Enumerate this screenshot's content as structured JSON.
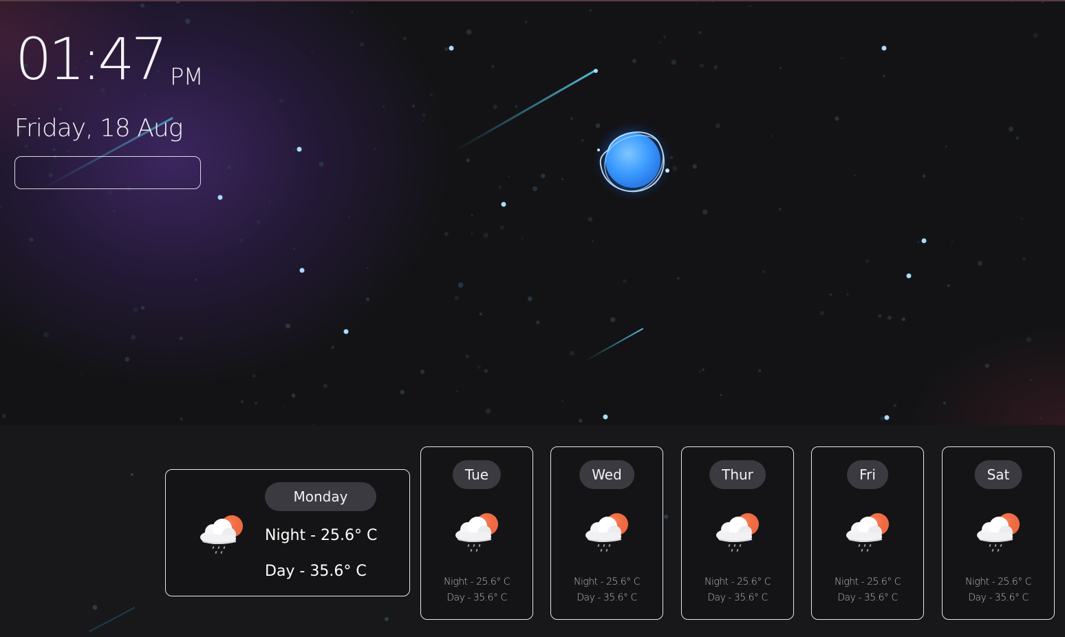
{
  "clock": {
    "time": "01:47",
    "ampm": "PM",
    "date": "Friday, 18 Aug"
  },
  "search": {
    "value": "",
    "placeholder": ""
  },
  "colors": {
    "background": "#131315",
    "panel": "#18181b",
    "pill": "#3a3a40",
    "moon": "#3a9dff",
    "star": "#a9dcff"
  },
  "forecast": {
    "today": {
      "day": "Monday",
      "night": "Night - 25.6° C",
      "daytemp": "Day - 35.6° C",
      "icon": "rain-cloud-sun-icon"
    },
    "days": [
      {
        "day": "Tue",
        "night": "Night - 25.6° C",
        "daytemp": "Day - 35.6° C",
        "icon": "rain-cloud-sun-icon"
      },
      {
        "day": "Wed",
        "night": "Night - 25.6° C",
        "daytemp": "Day - 35.6° C",
        "icon": "rain-cloud-sun-icon"
      },
      {
        "day": "Thur",
        "night": "Night - 25.6° C",
        "daytemp": "Day - 35.6° C",
        "icon": "rain-cloud-sun-icon"
      },
      {
        "day": "Fri",
        "night": "Night - 25.6° C",
        "daytemp": "Day - 35.6° C",
        "icon": "rain-cloud-sun-icon"
      },
      {
        "day": "Sat",
        "night": "Night - 25.6° C",
        "daytemp": "Day - 35.6° C",
        "icon": "rain-cloud-sun-icon"
      }
    ]
  }
}
